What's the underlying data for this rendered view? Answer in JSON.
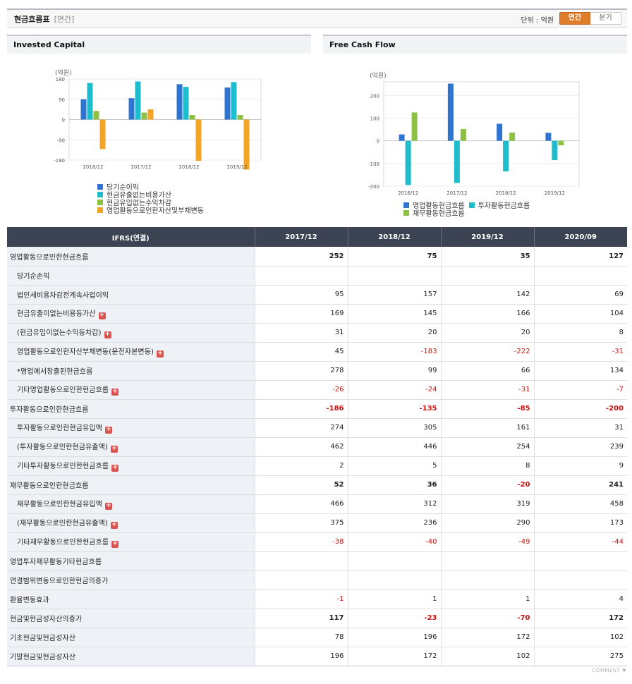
{
  "header": {
    "title": "현금흐름표",
    "subtitle": "[연간]",
    "unit_label": "단위 : 억원",
    "tabs": [
      {
        "label": "연간",
        "active": true
      },
      {
        "label": "분기",
        "active": false
      }
    ]
  },
  "charts": {
    "invested_capital": {
      "panel_title": "Invested Capital",
      "chart_data": {
        "type": "bar",
        "unit_label": "(억원)",
        "categories": [
          "2016/12",
          "2017/12",
          "2018/12",
          "2019/12"
        ],
        "ylim": [
          -180,
          180
        ],
        "yticks": [
          180,
          90,
          0,
          -90,
          -180
        ],
        "series": [
          {
            "name": "당기순이익",
            "color": "#2f74d0",
            "values": [
              90,
              95,
              157,
              142
            ]
          },
          {
            "name": "현금유출없는비용가산",
            "color": "#1fbccc",
            "values": [
              162,
              169,
              145,
              166
            ]
          },
          {
            "name": "현금유입없는수익차감",
            "color": "#8dc043",
            "values": [
              38,
              31,
              20,
              20
            ]
          },
          {
            "name": "영업활동으로인한자산및부채변동",
            "color": "#f5a42a",
            "values": [
              -131,
              45,
              -183,
              -222
            ]
          }
        ]
      }
    },
    "free_cash_flow": {
      "panel_title": "Free Cash Flow",
      "chart_data": {
        "type": "bar",
        "unit_label": "(억원)",
        "categories": [
          "2016/12",
          "2017/12",
          "2018/12",
          "2019/12"
        ],
        "ylim": [
          -200,
          260
        ],
        "yticks": [
          200,
          100,
          0,
          -100,
          -200
        ],
        "series": [
          {
            "name": "영업활동현금흐름",
            "color": "#2f74d0",
            "values": [
              28,
              252,
              75,
              35
            ]
          },
          {
            "name": "투자활동현금흐름",
            "color": "#1fbccc",
            "values": [
              -195,
              -186,
              -135,
              -85
            ]
          },
          {
            "name": "재무활동현금흐름",
            "color": "#8dc043",
            "values": [
              125,
              52,
              36,
              -20
            ]
          }
        ]
      }
    }
  },
  "table": {
    "corner_label": "IFRS(연결)",
    "columns": [
      "2017/12",
      "2018/12",
      "2019/12",
      "2020/09"
    ],
    "rows": [
      {
        "label": "영업활동으로인한현금흐름",
        "level": 0,
        "bold": true,
        "plus": false,
        "values": [
          "252",
          "75",
          "35",
          "127"
        ]
      },
      {
        "label": "당기순손익",
        "level": 1,
        "bold": false,
        "plus": false,
        "values": [
          "",
          "",
          "",
          ""
        ]
      },
      {
        "label": "법인세비용차감전계속사업이익",
        "level": 1,
        "bold": false,
        "plus": false,
        "values": [
          "95",
          "157",
          "142",
          "69"
        ]
      },
      {
        "label": "현금유출이없는비용등가산",
        "level": 1,
        "bold": false,
        "plus": true,
        "values": [
          "169",
          "145",
          "166",
          "104"
        ]
      },
      {
        "label": "(현금유입이없는수익등차감)",
        "level": 1,
        "bold": false,
        "plus": true,
        "values": [
          "31",
          "20",
          "20",
          "8"
        ]
      },
      {
        "label": "영업활동으로인한자산부채변동(운전자본변동)",
        "level": 1,
        "bold": false,
        "plus": true,
        "values": [
          "45",
          "-183",
          "-222",
          "-31"
        ]
      },
      {
        "label": "*영업에서창출된현금흐름",
        "level": 1,
        "bold": false,
        "plus": false,
        "values": [
          "278",
          "99",
          "66",
          "134"
        ]
      },
      {
        "label": "기타영업활동으로인한현금흐름",
        "level": 1,
        "bold": false,
        "plus": true,
        "values": [
          "-26",
          "-24",
          "-31",
          "-7"
        ]
      },
      {
        "label": "투자활동으로인한현금흐름",
        "level": 0,
        "bold": true,
        "plus": false,
        "values": [
          "-186",
          "-135",
          "-85",
          "-200"
        ]
      },
      {
        "label": "투자활동으로인한현금유입액",
        "level": 1,
        "bold": false,
        "plus": true,
        "values": [
          "274",
          "305",
          "161",
          "31"
        ]
      },
      {
        "label": "(투자활동으로인한현금유출액)",
        "level": 1,
        "bold": false,
        "plus": true,
        "values": [
          "462",
          "446",
          "254",
          "239"
        ]
      },
      {
        "label": "기타투자활동으로인한현금흐름",
        "level": 1,
        "bold": false,
        "plus": true,
        "values": [
          "2",
          "5",
          "8",
          "9"
        ]
      },
      {
        "label": "재무활동으로인한현금흐름",
        "level": 0,
        "bold": true,
        "plus": false,
        "values": [
          "52",
          "36",
          "-20",
          "241"
        ]
      },
      {
        "label": "재무활동으로인한현금유입액",
        "level": 1,
        "bold": false,
        "plus": true,
        "values": [
          "466",
          "312",
          "319",
          "458"
        ]
      },
      {
        "label": "(재무활동으로인한현금유출액)",
        "level": 1,
        "bold": false,
        "plus": true,
        "values": [
          "375",
          "236",
          "290",
          "173"
        ]
      },
      {
        "label": "기타재무활동으로인한현금흐름",
        "level": 1,
        "bold": false,
        "plus": true,
        "values": [
          "-38",
          "-40",
          "-49",
          "-44"
        ]
      },
      {
        "label": "영업투자재무활동기타현금흐름",
        "level": 0,
        "bold": false,
        "plus": false,
        "values": [
          "",
          "",
          "",
          ""
        ]
      },
      {
        "label": "연결범위변동으로인한현금의증가",
        "level": 0,
        "bold": false,
        "plus": false,
        "values": [
          "",
          "",
          "",
          ""
        ]
      },
      {
        "label": "환율변동효과",
        "level": 0,
        "bold": false,
        "plus": false,
        "values": [
          "-1",
          "1",
          "1",
          "4"
        ]
      },
      {
        "label": "현금및현금성자산의증가",
        "level": 0,
        "bold": true,
        "plus": false,
        "values": [
          "117",
          "-23",
          "-70",
          "172"
        ]
      },
      {
        "label": "기초현금및현금성자산",
        "level": 0,
        "bold": false,
        "plus": false,
        "values": [
          "78",
          "196",
          "172",
          "102"
        ]
      },
      {
        "label": "기말현금및현금성자산",
        "level": 0,
        "bold": false,
        "plus": false,
        "values": [
          "196",
          "172",
          "102",
          "275"
        ]
      }
    ]
  },
  "footer": {
    "comment_label": "COMMENT ▼"
  }
}
